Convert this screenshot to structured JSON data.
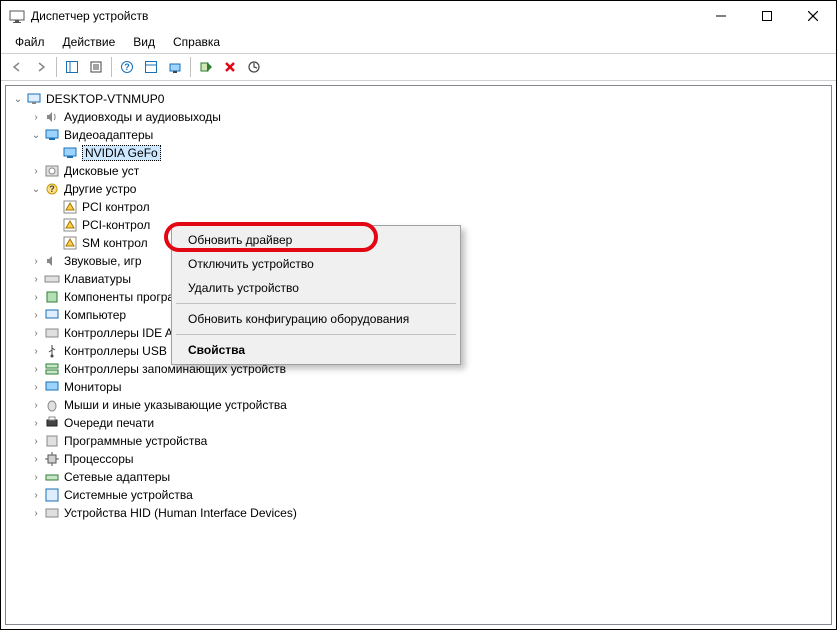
{
  "window": {
    "title": "Диспетчер устройств"
  },
  "menu": {
    "file": "Файл",
    "action": "Действие",
    "view": "Вид",
    "help": "Справка"
  },
  "tree": {
    "root": "DESKTOP-VTNMUP0",
    "audio": "Аудиовходы и аудиовыходы",
    "video": "Видеоадаптеры",
    "nvidia": "NVIDIA GeFo",
    "disk": "Дисковые уст",
    "other": "Другие устро",
    "pci1": "PCI контрол",
    "pci2": "PCI-контрол",
    "sm": "SM контрол",
    "sound": "Звуковые, игр",
    "keyboards": "Клавиатуры",
    "software": "Компоненты программного обеспечения",
    "computer": "Компьютер",
    "ide": "Контроллеры IDE ATA/ATAPI",
    "usb": "Контроллеры USB",
    "storage": "Контроллеры запоминающих устройств",
    "monitors": "Мониторы",
    "mice": "Мыши и иные указывающие устройства",
    "printq": "Очереди печати",
    "swdev": "Программные устройства",
    "cpu": "Процессоры",
    "net": "Сетевые адаптеры",
    "sysdev": "Системные устройства",
    "hid": "Устройства HID (Human Interface Devices)"
  },
  "context_menu": {
    "update": "Обновить драйвер",
    "disable": "Отключить устройство",
    "remove": "Удалить устройство",
    "rescan": "Обновить конфигурацию оборудования",
    "props": "Свойства"
  }
}
